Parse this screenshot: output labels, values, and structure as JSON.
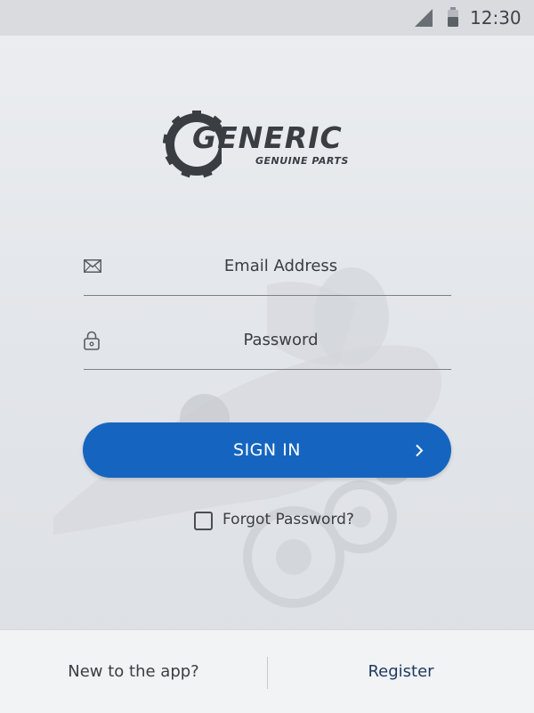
{
  "status_bar": {
    "time": "12:30",
    "icons": [
      "signal-icon",
      "battery-icon"
    ]
  },
  "logo": {
    "brand": "GENERIC",
    "tagline": "GENUINE PARTS",
    "icon": "gear-icon"
  },
  "login_form": {
    "email": {
      "placeholder": "Email Address",
      "value": "",
      "icon": "envelope-icon"
    },
    "password": {
      "placeholder": "Password",
      "value": "",
      "icon": "lock-icon"
    },
    "sign_in_label": "SIGN IN",
    "sign_in_icon": "chevron-right-icon",
    "forgot_password_label": "Forgot Password?",
    "forgot_password_checked": false
  },
  "footer": {
    "new_user_text": "New to the app?",
    "register_label": "Register"
  },
  "colors": {
    "accent": "#1565c0",
    "text": "#3a3d42",
    "background": "#e3e6ea",
    "footer_background": "#f2f3f5"
  }
}
